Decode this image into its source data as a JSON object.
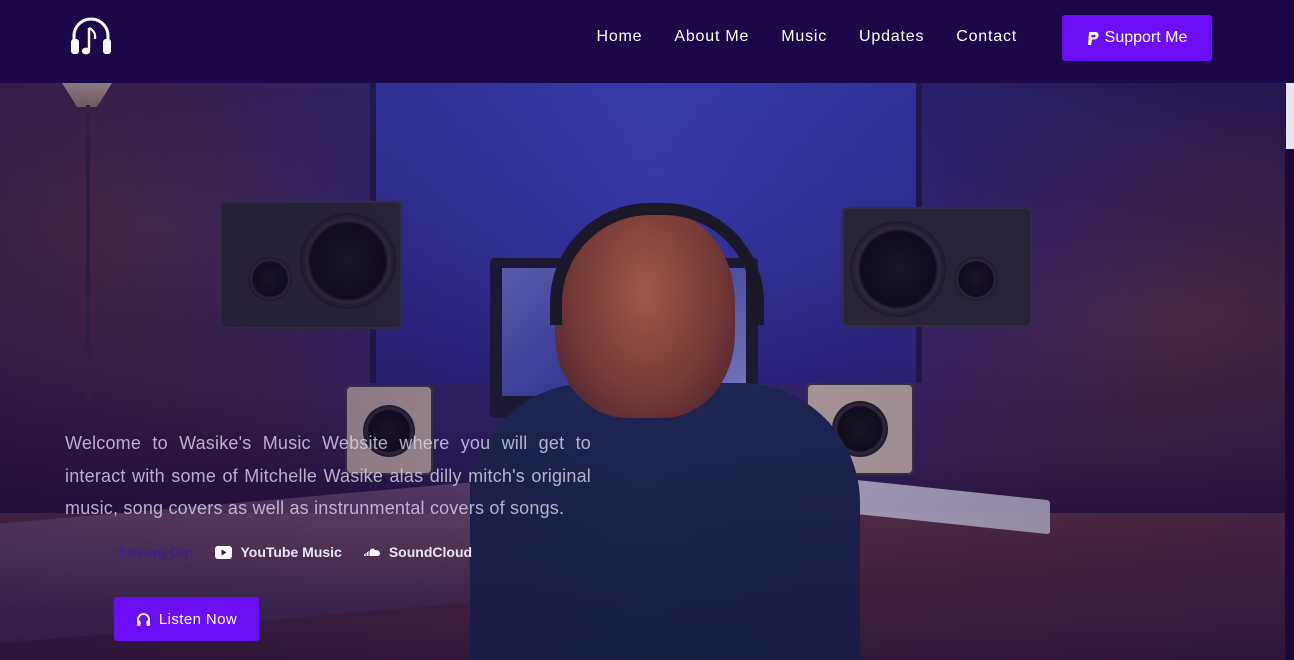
{
  "nav": {
    "links": [
      "Home",
      "About Me",
      "Music",
      "Updates",
      "Contact"
    ],
    "support_label": "Support Me"
  },
  "hero": {
    "intro": "Welcome to Wasike's Music Website where you will get to interact with some of Mitchelle Wasike alas dilly mitch's original music, song covers as well as instrunmental covers of songs.",
    "stream_label": "Stream On:",
    "platforms": [
      "YouTube Music",
      "SoundCloud"
    ],
    "listen_label": "Listen Now"
  },
  "colors": {
    "navbar": "#1b0848",
    "accent": "#6a0ff5"
  },
  "icons": {
    "logo": "headphones-music-note-icon",
    "support": "paypal-icon",
    "youtube": "youtube-play-icon",
    "soundcloud": "soundcloud-icon",
    "listen": "headphones-icon"
  }
}
